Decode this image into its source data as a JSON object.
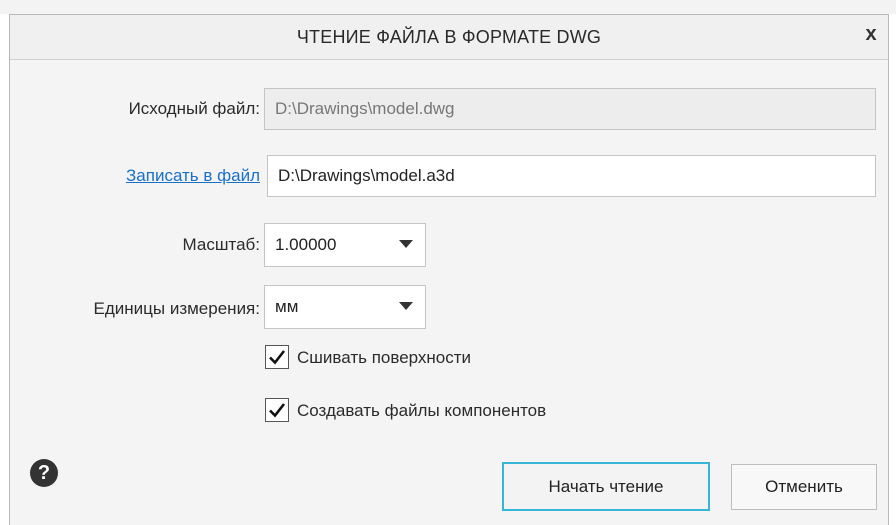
{
  "dialog": {
    "title": "ЧТЕНИЕ ФАЙЛА В ФОРМАТЕ DWG",
    "close_label": "x"
  },
  "source_file": {
    "label": "Исходный файл:",
    "value": "D:\\Drawings\\model.dwg"
  },
  "output_file": {
    "link_label": "Записать в файл",
    "value": "D:\\Drawings\\model.a3d"
  },
  "scale": {
    "label": "Масштаб:",
    "value": "1.00000"
  },
  "units": {
    "label": "Единицы измерения:",
    "value": "мм"
  },
  "options": {
    "stitch_surfaces": {
      "label": "Сшивать поверхности",
      "checked": true
    },
    "create_component_files": {
      "label": "Создавать файлы компонентов",
      "checked": true
    }
  },
  "buttons": {
    "help_symbol": "?",
    "start": "Начать чтение",
    "cancel": "Отменить"
  },
  "icons": [
    "close-icon",
    "chevron-down-icon",
    "checkmark-icon",
    "help-icon"
  ],
  "colors": {
    "link": "#1a6fc6",
    "primary_border": "#35b6d6"
  }
}
